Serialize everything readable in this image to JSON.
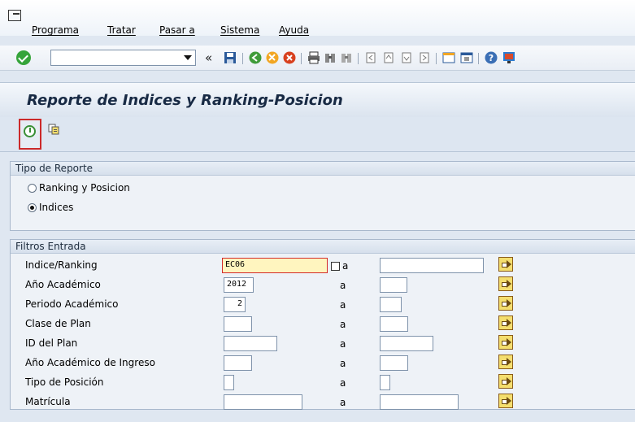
{
  "menu": {
    "items": [
      {
        "label": "Programa"
      },
      {
        "label": "Tratar"
      },
      {
        "label": "Pasar a"
      },
      {
        "label": "Sistema"
      },
      {
        "label": "Ayuda"
      }
    ]
  },
  "toolbar": {
    "command_value": "",
    "chevron": "«",
    "icons": [
      "save-icon",
      "back-icon",
      "exit-icon",
      "cancel-icon",
      "print-icon",
      "find-icon",
      "find-next-icon",
      "first-page-icon",
      "prev-page-icon",
      "next-page-icon",
      "last-page-icon",
      "new-session-icon",
      "shortcut-icon",
      "help-icon",
      "layout-icon"
    ]
  },
  "title": "Reporte de Indices y Ranking-Posicion",
  "report_type": {
    "header": "Tipo de Reporte",
    "options": [
      {
        "label": "Ranking y Posicion",
        "selected": false
      },
      {
        "label": "Indices",
        "selected": true
      }
    ]
  },
  "filters": {
    "header": "Filtros Entrada",
    "to_label": "a",
    "rows": [
      {
        "label": "Indice/Ranking",
        "from": "EC06",
        "to": ""
      },
      {
        "label": "Año Académico",
        "from": "2012",
        "to": ""
      },
      {
        "label": "Periodo Académico",
        "from": "2",
        "to": ""
      },
      {
        "label": "Clase de Plan",
        "from": "",
        "to": ""
      },
      {
        "label": "ID del Plan",
        "from": "",
        "to": ""
      },
      {
        "label": "Año Académico de Ingreso",
        "from": "",
        "to": ""
      },
      {
        "label": "Tipo de Posición",
        "from": "",
        "to": ""
      },
      {
        "label": "Matrícula",
        "from": "",
        "to": ""
      }
    ]
  },
  "colors": {
    "ok_green": "#35a43a",
    "highlight_red": "#cc2a2a",
    "active_field": "#fff5bf",
    "title_text": "#182a44"
  }
}
